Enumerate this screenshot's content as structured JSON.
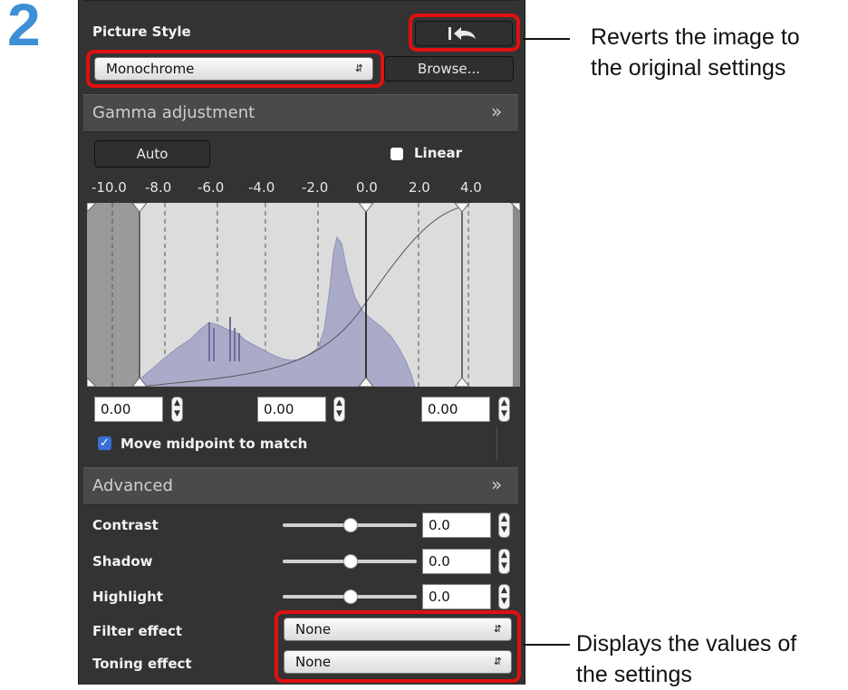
{
  "step_number": "2",
  "picture_style": {
    "label": "Picture Style",
    "revert_icon": "revert-arrow-icon",
    "style_value": "Monochrome",
    "browse_label": "Browse..."
  },
  "gamma": {
    "header": "Gamma adjustment",
    "auto_label": "Auto",
    "linear_label": "Linear",
    "linear_checked": false,
    "ticks": [
      "-10.0",
      "-8.0",
      "-6.0",
      "-4.0",
      "-2.0",
      "0.0",
      "2.0",
      "4.0"
    ],
    "fields": [
      "0.00",
      "0.00",
      "0.00"
    ],
    "midpoint_label": "Move midpoint to match",
    "midpoint_checked": true
  },
  "advanced": {
    "header": "Advanced",
    "sliders": [
      {
        "label": "Contrast",
        "value": "0.0"
      },
      {
        "label": "Shadow",
        "value": "0.0"
      },
      {
        "label": "Highlight",
        "value": "0.0"
      }
    ],
    "filter_label": "Filter effect",
    "filter_value": "None",
    "toning_label": "Toning effect",
    "toning_value": "None"
  },
  "annotations": {
    "revert": [
      "Reverts the image to",
      "the original settings"
    ],
    "values": [
      "Displays the values of",
      "the settings"
    ]
  },
  "colors": {
    "panel": "#333333",
    "highlight_box": "#e01010",
    "step": "#3d8fd6"
  }
}
